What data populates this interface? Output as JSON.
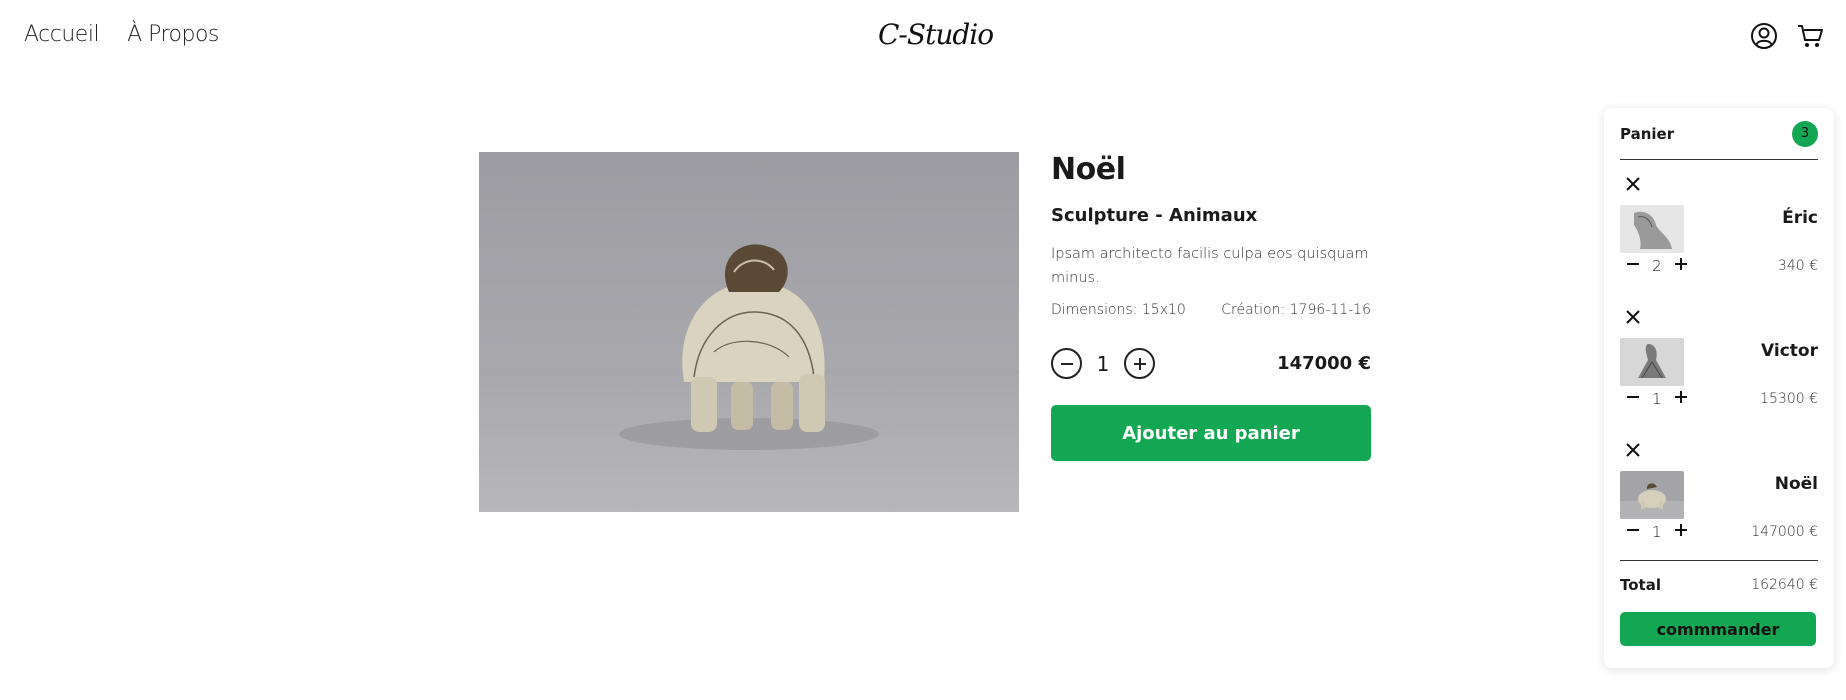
{
  "nav": {
    "home": "Accueil",
    "about": "À Propos"
  },
  "brand": {
    "logo": "C-Studio"
  },
  "header_icons": [
    "user-icon",
    "cart-icon"
  ],
  "product": {
    "title": "Noël",
    "category": "Sculpture - Animaux",
    "description": "Ipsam architecto facilis culpa eos quisquam minus.",
    "dimensions": "Dimensions: 15x10",
    "creation": "Création: 1796-11-16",
    "quantity": "1",
    "price": "147000 €",
    "add_label": "Ajouter au panier"
  },
  "cart": {
    "title": "Panier",
    "count": "3",
    "items": [
      {
        "name": "Éric",
        "qty": "2",
        "price": "340 €"
      },
      {
        "name": "Victor",
        "qty": "1",
        "price": "15300 €"
      },
      {
        "name": "Noël",
        "qty": "1",
        "price": "147000 €"
      }
    ],
    "total_label": "Total",
    "total_value": "162640 €",
    "order_label": "commmander"
  },
  "colors": {
    "accent": "#14a753",
    "text": "#1a1a1a"
  }
}
